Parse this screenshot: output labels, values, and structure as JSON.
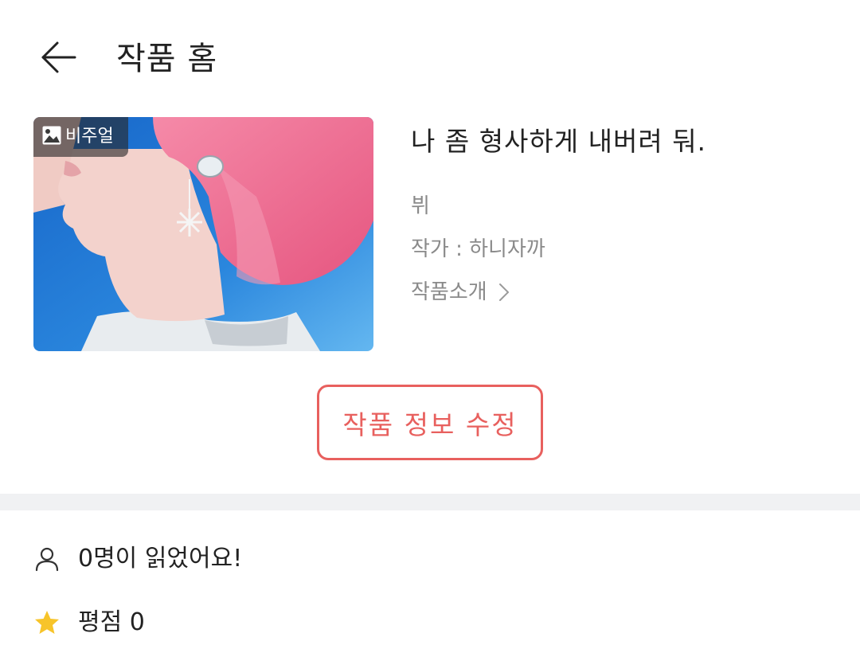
{
  "header": {
    "title": "작품 홈",
    "back_icon": "arrow-left-icon"
  },
  "cover": {
    "badge_icon": "image-icon",
    "badge_label": "비주얼",
    "colors": {
      "hair": "#ee6b8e",
      "background": "#1e6fd0",
      "skin": "#f3d2cc"
    }
  },
  "work": {
    "title": "나 좀 형사하게 내버려 둬.",
    "genre": "뷔",
    "author": "작가 : 하니자까",
    "intro_label": "작품소개",
    "intro_icon": "chevron-right-icon"
  },
  "actions": {
    "edit_label": "작품 정보 수정"
  },
  "stats": {
    "reads_icon": "user-icon",
    "reads_text": "0명이 읽었어요!",
    "rating_icon": "star-icon",
    "rating_text": "평점 0"
  },
  "colors": {
    "accent": "#e8605e",
    "muted_text": "#8a8a8a",
    "divider": "#f0f1f3",
    "star": "#f7c42a"
  }
}
